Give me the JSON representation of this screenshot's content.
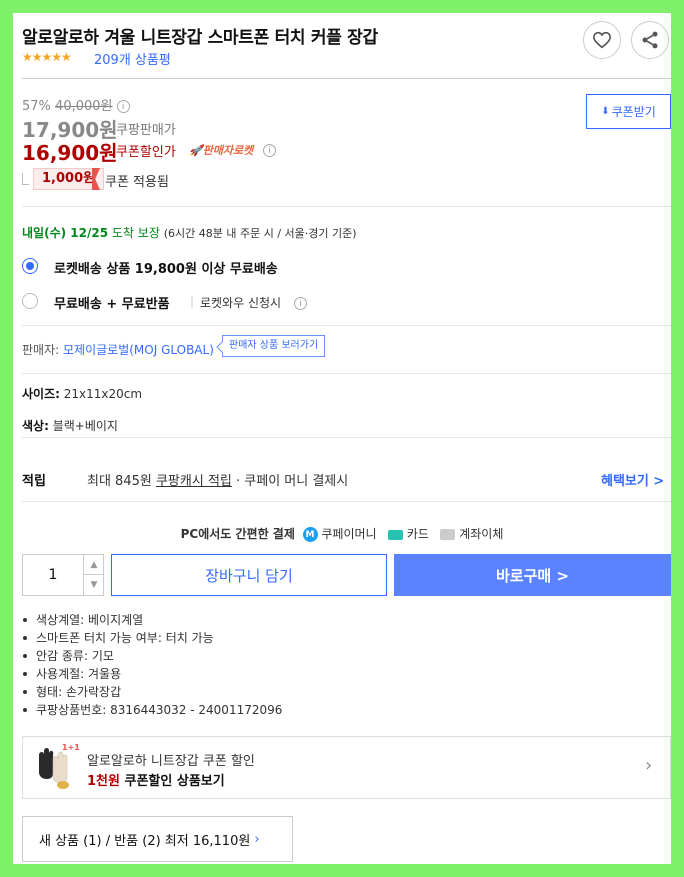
{
  "product": {
    "title": "알로알로하 겨울 니트장갑 스마트폰 터치 커플 장갑",
    "stars": "★★★★★",
    "review_count": "209개 상품평"
  },
  "price": {
    "discount_rate": "57%",
    "original_price": "40,000원",
    "coupang_price": "17,900원",
    "coupang_price_label": "쿠팡판매가",
    "coupon_price": "16,900원",
    "coupon_price_label": "쿠폰할인가",
    "rocket_label": "🚀판매자로켓",
    "coupon_amount": "1,000원",
    "coupon_applied": "쿠폰 적용됨",
    "coupon_button": "쿠폰받기"
  },
  "delivery": {
    "date": "내일(수) 12/25",
    "guarantee": "도착 보장",
    "note": "(6시간 48분  내 주문 시 / 서울·경기 기준)"
  },
  "shipping_options": [
    {
      "label": "로켓배송 상품 19,800원 이상 무료배송",
      "sub": "",
      "selected": true
    },
    {
      "label": "무료배송 + 무료반품",
      "sub": "로켓와우 신청시",
      "selected": false
    }
  ],
  "seller": {
    "label": "판매자:",
    "name": "모제이글로벌(MOJ GLOBAL)",
    "button": "판매자 상품 보러가기"
  },
  "options": {
    "size_label": "사이즈:",
    "size_value": "21x11x20cm",
    "color_label": "색상:",
    "color_value": "블랙+베이지"
  },
  "mileage": {
    "label": "적립",
    "text_prefix": "최대 845원 ",
    "text_link": "쿠팡캐시 적립",
    "text_suffix": " · 쿠페이 머니 결제시",
    "benefit_link": "혜택보기 >"
  },
  "payment": {
    "heading": "PC에서도 간편한 결제",
    "coupay_badge": "M",
    "coupay": "쿠페이머니",
    "card": "카드",
    "bank": "계좌이체"
  },
  "purchase": {
    "quantity": "1",
    "cart_button": "장바구니 담기",
    "buy_button": "바로구매 >"
  },
  "attributes": [
    "색상계열: 베이지계열",
    "스마트폰 터치 가능 여부: 터치 가능",
    "안감 종류: 기모",
    "사용계절: 겨울용",
    "형태: 손가락장갑",
    "쿠팡상품번호: 8316443032 - 24001172096"
  ],
  "promo": {
    "badge": "1+1",
    "title": "알로알로하 니트장갑 쿠폰 할인",
    "highlight": "1천원",
    "subtitle": " 쿠폰할인 상품보기",
    "arrow": "›"
  },
  "used": {
    "text": "새 상품 (1) / 반품 (2) 최저 16,110원",
    "arrow": "›"
  },
  "colors": {
    "brand_blue": "#346aff",
    "price_red": "#ae0000",
    "delivery_green": "#00891a",
    "star": "#f5a623"
  }
}
